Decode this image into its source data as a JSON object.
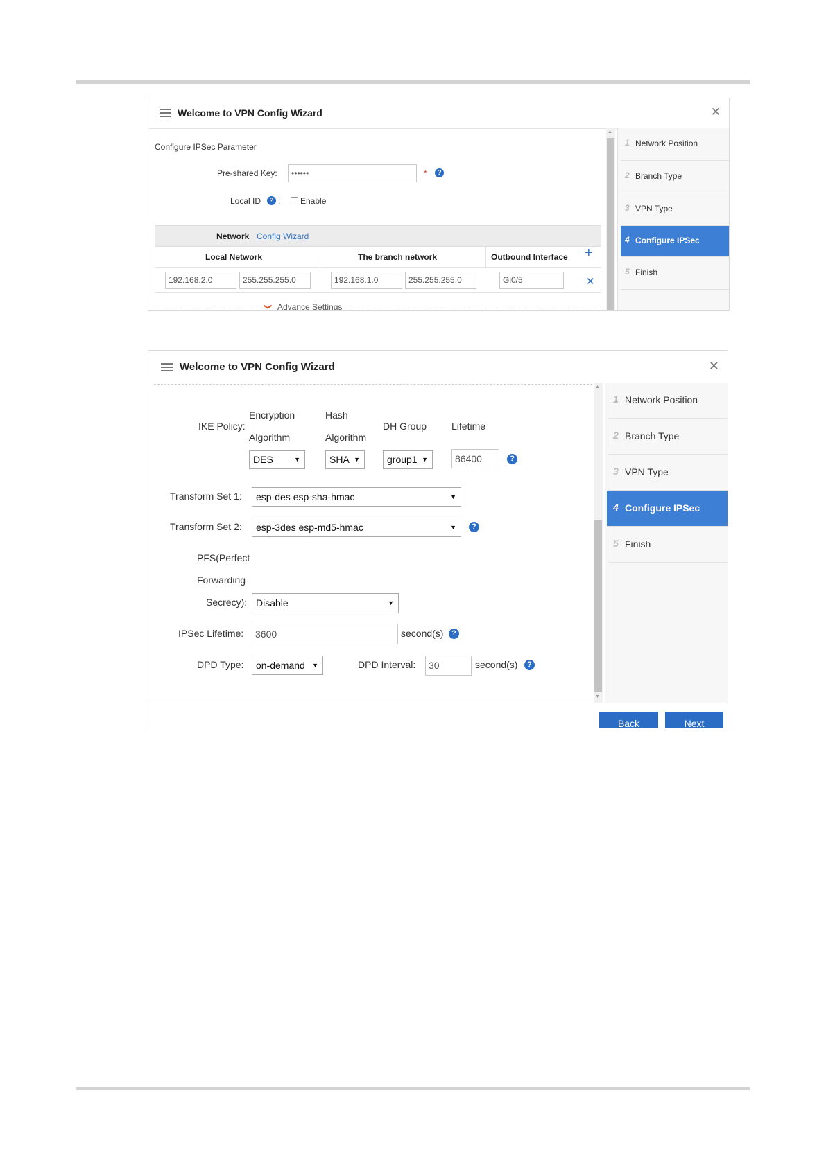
{
  "wizard_top": {
    "title": "Welcome to VPN Config Wizard",
    "section_title": "Configure IPSec Parameter",
    "psk_label": "Pre-shared Key:",
    "psk_value": "••••••",
    "required_mark": "*",
    "local_id_label": "Local ID",
    "local_id_colon": ":",
    "enable_label": "Enable",
    "network_wizard_prefix": "Network",
    "network_wizard_link": "Config Wizard",
    "table": {
      "headers": [
        "Local Network",
        "The branch network",
        "Outbound Interface"
      ],
      "row": {
        "local_ip": "192.168.2.0",
        "local_mask": "255.255.255.0",
        "branch_ip": "192.168.1.0",
        "branch_mask": "255.255.255.0",
        "interface": "Gi0/5"
      }
    },
    "advance_settings": "Advance Settings"
  },
  "wizard_bottom": {
    "title": "Welcome to VPN Config Wizard",
    "ike_policy_label": "IKE Policy:",
    "ike_headers": {
      "enc1": "Encryption",
      "enc2": "Algorithm",
      "hash1": "Hash",
      "hash2": "Algorithm",
      "dh": "DH Group",
      "lifetime": "Lifetime"
    },
    "ike_values": {
      "encryption": "DES",
      "hash": "SHA",
      "dh_group": "group1",
      "lifetime": "86400"
    },
    "transform1_label": "Transform Set 1:",
    "transform1_value": "esp-des esp-sha-hmac",
    "transform2_label": "Transform Set 2:",
    "transform2_value": "esp-3des esp-md5-hmac",
    "pfs_label_line1": "PFS(Perfect",
    "pfs_label_line2": "Forwarding",
    "pfs_label_line3": "Secrecy):",
    "pfs_value": "Disable",
    "ipsec_lifetime_label": "IPSec Lifetime:",
    "ipsec_lifetime_value": "3600",
    "seconds_label": "second(s)",
    "dpd_type_label": "DPD Type:",
    "dpd_type_value": "on-demand",
    "dpd_interval_label": "DPD Interval:",
    "dpd_interval_value": "30",
    "back_button": "Back",
    "next_button": "Next"
  },
  "nav_steps": [
    {
      "num": "1",
      "label": "Network Position"
    },
    {
      "num": "2",
      "label": "Branch Type"
    },
    {
      "num": "3",
      "label": "VPN Type"
    },
    {
      "num": "4",
      "label": "Configure IPSec"
    },
    {
      "num": "5",
      "label": "Finish"
    }
  ],
  "glyphs": {
    "close": "✕",
    "help": "?",
    "caret": "▼",
    "plus": "+",
    "remove": "✕",
    "chevron": "❯",
    "scroll_up": "▲",
    "scroll_down": "▼"
  },
  "colors": {
    "accent": "#3c7fd4",
    "button": "#2b6cc4",
    "required": "#e03c31",
    "link": "#2f73c5",
    "chevron": "#e05a2b"
  }
}
